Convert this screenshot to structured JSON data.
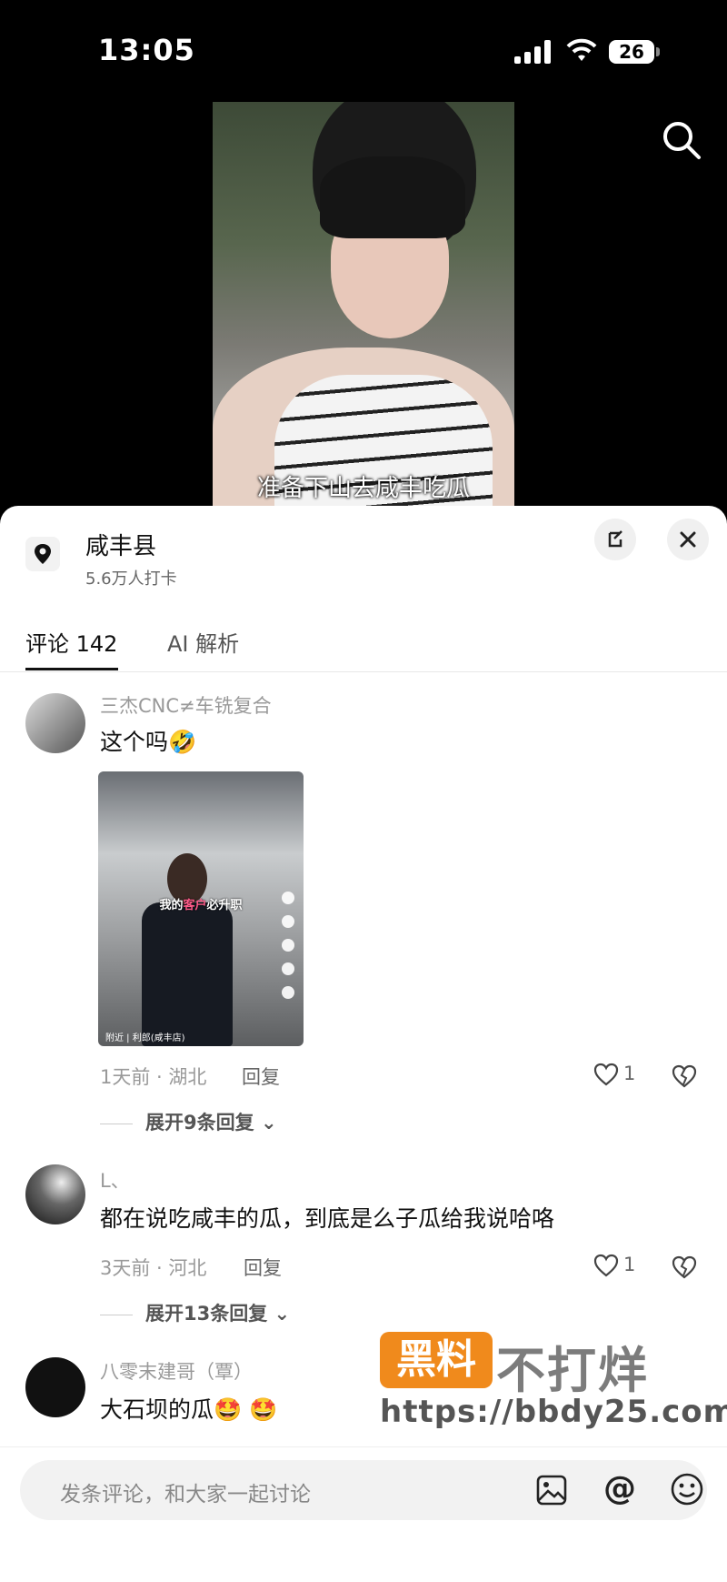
{
  "status": {
    "time": "13:05",
    "battery": "26"
  },
  "video": {
    "subtitle": "准备下山去咸丰吃瓜"
  },
  "location": {
    "title": "咸丰县",
    "subtitle": "5.6万人打卡"
  },
  "tabs": [
    {
      "label": "评论 142"
    },
    {
      "label": "AI 解析"
    }
  ],
  "comments": [
    {
      "username": "三杰CNC≠车铣复合",
      "text": "这个吗🤣",
      "meta": "1天前 · 湖北",
      "reply": "回复",
      "likes": "1",
      "expand": "展开9条回复",
      "image": {
        "caption_prefix": "我的",
        "caption_highlight": "客户",
        "caption_suffix": "必升职",
        "location_tag": "附近 | 利郎(咸丰店)"
      }
    },
    {
      "username": "L、",
      "text": "都在说吃咸丰的瓜，到底是么子瓜给我说哈咯",
      "meta": "3天前 · 河北",
      "reply": "回复",
      "likes": "1",
      "expand": "展开13条回复"
    },
    {
      "username": "八零末建哥（覃）",
      "text": "大石坝的瓜🤩 🤩"
    }
  ],
  "watermark": {
    "badge": "黑料",
    "title": "不打烊",
    "url": "https://bbdy25.com"
  },
  "input": {
    "placeholder": "发条评论，和大家一起讨论"
  },
  "icons": {
    "location": "location-pin-icon",
    "search": "search-icon",
    "expand": "expand-icon",
    "close": "close-icon",
    "like": "heart-icon",
    "dislike": "broken-heart-icon",
    "image": "image-icon",
    "at": "at-icon",
    "emoji": "emoji-icon"
  }
}
